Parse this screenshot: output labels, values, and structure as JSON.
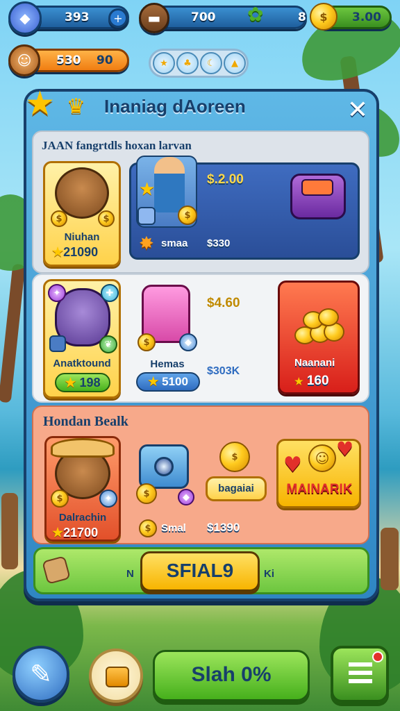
{
  "top_bar": {
    "gems_value": "393",
    "energy_value": "700",
    "badge_count": "8",
    "coins_value": "3.00",
    "xp_value": "530",
    "level_value": "90"
  },
  "dialog": {
    "title": "Inaniag dAoreen",
    "section1": {
      "heading": "JAAN fangrtdls hoxan larvan",
      "bear_card": {
        "name": "Niuhan",
        "price": "21090"
      },
      "offer_price": "$.2.00",
      "offer_small_label": "smaa",
      "offer_small_price": "$330"
    },
    "section2": {
      "otter_card": {
        "name": "Anatktound",
        "price": "198"
      },
      "chest_name": "Hemas",
      "chest_price": "5100",
      "price_top": "$4.60",
      "price_bottom": "$303K",
      "coins_card": {
        "name": "Naanani",
        "price": "160"
      }
    },
    "section3": {
      "heading": "Hondan Bealk",
      "bear_card": {
        "name": "Dalrachin",
        "price": "21700"
      },
      "badge_label": "bagaiai",
      "small_label": "Smal",
      "small_price": "$1390",
      "banner": "MAINARIK"
    },
    "footer": {
      "left": "N",
      "button": "SFIAL9",
      "right": "Ki"
    }
  },
  "bottom_bar": {
    "play_button": "Slah 0%"
  },
  "colors": {
    "panel_border": "#173f6b",
    "accent_yellow": "#ffcb1f",
    "accent_green": "#46b01c",
    "accent_red": "#e2302a"
  }
}
